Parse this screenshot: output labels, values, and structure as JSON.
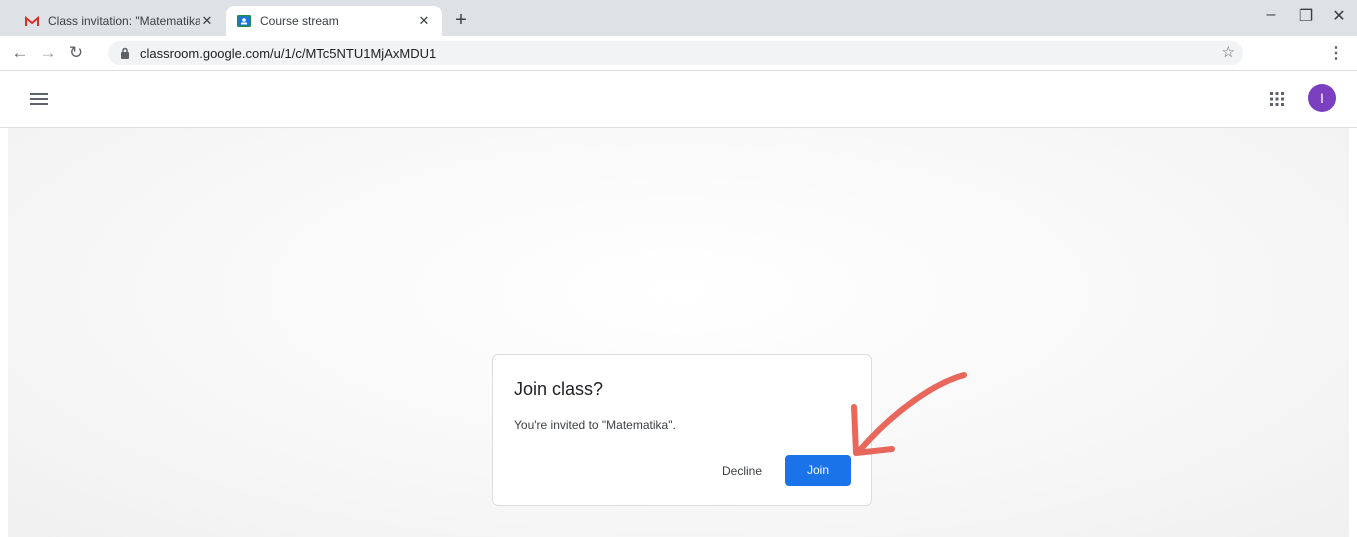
{
  "browser": {
    "tabs": [
      {
        "title": "Class invitation: \"Matematika IV-",
        "favicon": "gmail-icon",
        "active": false
      },
      {
        "title": "Course stream",
        "favicon": "classroom-icon",
        "active": true
      }
    ],
    "new_tab_label": "+",
    "address_bar": {
      "url": "classroom.google.com/u/1/c/MTc5NTU1MjAxMDU1"
    }
  },
  "appbar": {
    "avatar_initial": "I",
    "avatar_color": "#7b3fbf"
  },
  "dialog": {
    "title": "Join class?",
    "message": "You're invited to \"Matematika\".",
    "decline_label": "Decline",
    "join_label": "Join"
  },
  "colors": {
    "accent": "#1a73e8",
    "annotation_arrow": "#e8665a"
  }
}
